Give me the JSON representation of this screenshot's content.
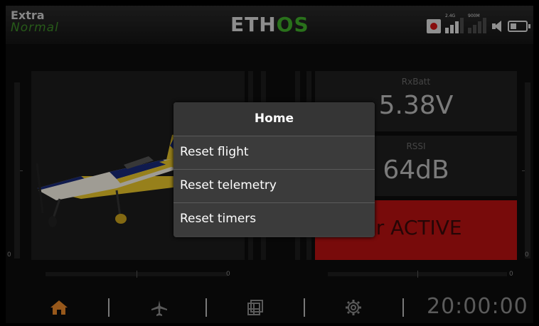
{
  "header": {
    "model_name": "Extra",
    "flight_mode": "Normal",
    "logo_part1": "ETH",
    "logo_part2": "OS",
    "rf1_label": "2.4G",
    "rf2_label": "900M"
  },
  "trims": {
    "left_vertical": "0",
    "right_vertical": "0",
    "left_horizontal": "0",
    "right_horizontal": "0"
  },
  "telemetry": [
    {
      "label": "RxBatt",
      "value": "5.38V"
    },
    {
      "label": "RSSI",
      "value": "64dB"
    },
    {
      "label": "",
      "value": "hr ACTIVE"
    }
  ],
  "footer": {
    "clock": "20:00:00"
  },
  "dialog": {
    "title": "Home",
    "items": [
      "Reset flight",
      "Reset telemetry",
      "Reset timers"
    ]
  },
  "colors": {
    "accent_green": "#3fae2a",
    "alert_red": "#b81212",
    "home_orange": "#e8882a"
  },
  "icons": [
    "record-icon",
    "signal-2g4-icon",
    "signal-900m-icon",
    "speaker-icon",
    "battery-icon",
    "home-icon",
    "airplane-icon",
    "layout-icon",
    "gear-icon"
  ]
}
